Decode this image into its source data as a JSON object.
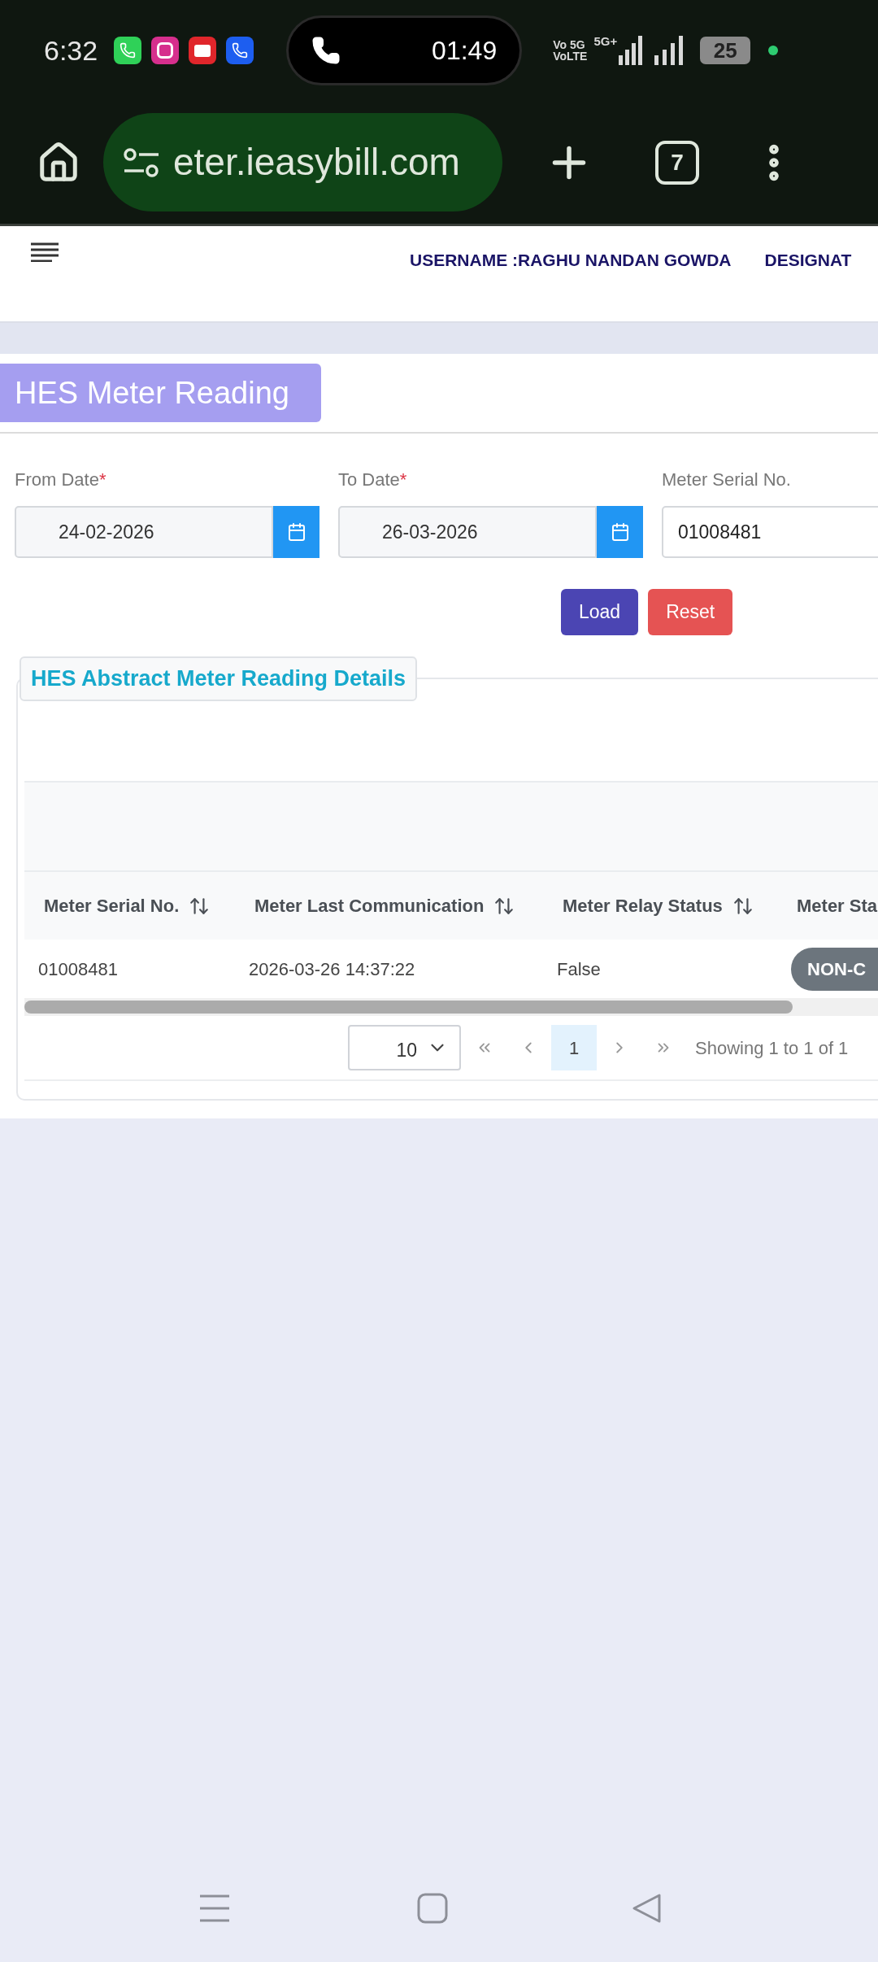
{
  "status_bar": {
    "time": "6:32",
    "call_timer": "01:49",
    "network_top": "Vo 5G",
    "network_bottom": "VoLTE",
    "network_type": "5G+",
    "battery": "25"
  },
  "browser": {
    "url": "eter.ieasybill.com",
    "tab_count": "7"
  },
  "header": {
    "username": "USERNAME :RAGHU NANDAN GOWDA",
    "designation": "DESIGNAT"
  },
  "page": {
    "title": "HES Meter Reading"
  },
  "form": {
    "fields": [
      {
        "kind": "date",
        "label": "From Date",
        "required_mark": "*",
        "value": "24-02-2026"
      },
      {
        "kind": "date",
        "label": "To Date",
        "required_mark": "*",
        "value": "26-03-2026"
      },
      {
        "kind": "text",
        "label": "Meter Serial No.",
        "value": "01008481"
      }
    ],
    "buttons": [
      {
        "kind": "primary",
        "label": "Load"
      },
      {
        "kind": "danger",
        "label": "Reset"
      }
    ]
  },
  "details": {
    "legend": "HES Abstract Meter Reading Details",
    "table": {
      "columns": [
        {
          "label": "Meter Serial No.",
          "sortable": true
        },
        {
          "label": "Meter Last Communication",
          "sortable": true
        },
        {
          "label": "Meter Relay Status",
          "sortable": true
        },
        {
          "label": "Meter Sta",
          "sortable": false
        }
      ],
      "rows": [
        {
          "cells": [
            {
              "kind": "text",
              "text": "01008481"
            },
            {
              "kind": "text",
              "text": "2026-03-26 14:37:22"
            },
            {
              "kind": "text",
              "text": "False"
            },
            {
              "kind": "badge",
              "text": "NON-C"
            }
          ]
        }
      ]
    },
    "pagination": {
      "page_size": "10",
      "pages": [
        {
          "label": "1",
          "selected": true
        }
      ],
      "summary": "Showing 1 to 1 of 1"
    }
  }
}
